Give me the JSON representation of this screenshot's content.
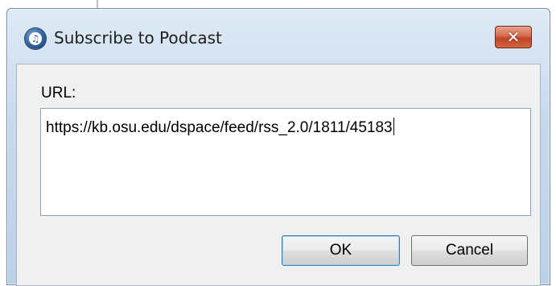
{
  "dialog": {
    "title": "Subscribe to Podcast",
    "close_label": "✕",
    "url_label": "URL:",
    "url_value": "https://kb.osu.edu/dspace/feed/rss_2.0/1811/45183",
    "ok_label": "OK",
    "cancel_label": "Cancel",
    "app_icon_glyph": "♫"
  },
  "colors": {
    "close_button": "#c0432a",
    "title_bar": "#c9d9ec",
    "client_bg": "#f0f0f0"
  },
  "icons": {
    "app": "itunes-icon",
    "close": "close-icon"
  }
}
